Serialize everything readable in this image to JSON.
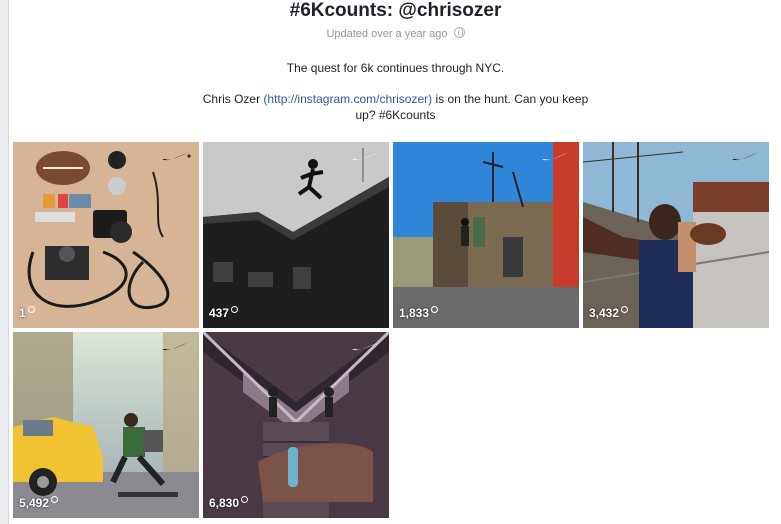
{
  "post": {
    "title": "#6Kcounts: @chrisozer",
    "updated": "Updated over a year ago",
    "desc_line1": "The quest for 6k continues through NYC.",
    "desc_name": "Chris Ozer",
    "desc_link": "(http://instagram.com/chrisozer)",
    "desc_rest": " is on the hunt. Can you keep up? #6Kcounts"
  },
  "photos": [
    {
      "count": "1",
      "subject": "camera gear flat-lay"
    },
    {
      "count": "437",
      "subject": "silhouette jumping on wall"
    },
    {
      "count": "1,833",
      "subject": "rooftop climber with graffiti"
    },
    {
      "count": "3,432",
      "subject": "man throwing football near ship"
    },
    {
      "count": "5,492",
      "subject": "skateboarder and yellow taxi"
    },
    {
      "count": "6,830",
      "subject": "wristband on stairs under bridge"
    }
  ],
  "colors": {
    "link": "#365899",
    "meta": "#90949c",
    "text": "#1d2129"
  },
  "icons": [
    "globe-icon",
    "nike-swoosh-icon"
  ]
}
